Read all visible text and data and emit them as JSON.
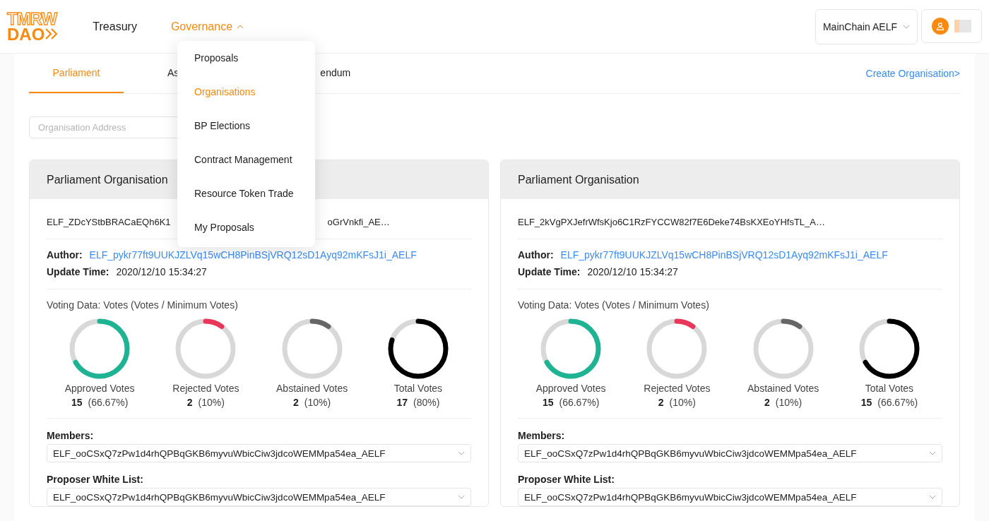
{
  "logo": {
    "top": "TMRW",
    "bottom": "DAO"
  },
  "nav": [
    {
      "label": "Treasury",
      "selected": false,
      "has_caret": false
    },
    {
      "label": "Governance",
      "selected": true,
      "has_caret": true
    }
  ],
  "chain_select": {
    "value": "MainChain AELF"
  },
  "dropdown": [
    {
      "label": "Proposals",
      "selected": false
    },
    {
      "label": "Organisations",
      "selected": true
    },
    {
      "label": "BP Elections",
      "selected": false
    },
    {
      "label": "Contract Management",
      "selected": false
    },
    {
      "label": "Resource Token Trade",
      "selected": false
    },
    {
      "label": "My Proposals",
      "selected": false
    }
  ],
  "tabs": [
    {
      "label": "Parliament",
      "selected": true
    },
    {
      "label": "As",
      "selected": false
    },
    {
      "label": "endum",
      "selected": false
    }
  ],
  "create_link": "Create Organisation>",
  "search": {
    "placeholder": "Organisation Address"
  },
  "cards": [
    {
      "title": "Parliament Organisation",
      "address": [
        "ELF_ZDcYStbBRACaEQh6K1",
        "oGrVnkfi_AE…"
      ],
      "author_label": "Author:",
      "author": "ELF_pykr77ft9UUKJZLVq15wCH8PinBSjVRQ12sD1Ayq92mKFsJ1i_AELF",
      "time_label": "Update Time:",
      "time": "2020/12/10 15:34:27",
      "voting_title": "Voting Data: Votes (Votes / Minimum Votes)",
      "votes": [
        {
          "label": "Approved Votes",
          "count": "15",
          "pct": "(66.67%)",
          "color": "#1db393",
          "level": 0.6667
        },
        {
          "label": "Rejected Votes",
          "count": "2",
          "pct": "(10%)",
          "color": "#e8375a",
          "level": 0.1
        },
        {
          "label": "Abstained Votes",
          "count": "2",
          "pct": "(10%)",
          "color": "#666666",
          "level": 0.1
        },
        {
          "label": "Total Votes",
          "count": "17",
          "pct": "(80%)",
          "color": "#000000",
          "level": 0.8
        }
      ],
      "members_label": "Members:",
      "members": "ELF_ooCSxQ7zPw1d4rhQPBqGKB6myvuWbicCiw3jdcoWEMMpa54ea_AELF",
      "whitelist_label": "Proposer White List:",
      "whitelist": "ELF_ooCSxQ7zPw1d4rhQPBqGKB6myvuWbicCiw3jdcoWEMMpa54ea_AELF"
    },
    {
      "title": "Parliament Organisation",
      "address": [
        "ELF_2kVgPXJefrWfsKjo6C1RzFYCCW82f7E6Deke74BsKXEoYHfsTL_A…"
      ],
      "author_label": "Author:",
      "author": "ELF_pykr77ft9UUKJZLVq15wCH8PinBSjVRQ12sD1Ayq92mKFsJ1i_AELF",
      "time_label": "Update Time:",
      "time": "2020/12/10 15:34:27",
      "voting_title": "Voting Data: Votes (Votes / Minimum Votes)",
      "votes": [
        {
          "label": "Approved Votes",
          "count": "15",
          "pct": "(66.67%)",
          "color": "#1db393",
          "level": 0.6667
        },
        {
          "label": "Rejected Votes",
          "count": "2",
          "pct": "(10%)",
          "color": "#e8375a",
          "level": 0.1
        },
        {
          "label": "Abstained Votes",
          "count": "2",
          "pct": "(10%)",
          "color": "#666666",
          "level": 0.1
        },
        {
          "label": "Total Votes",
          "count": "15",
          "pct": "(66.67%)",
          "color": "#000000",
          "level": 0.6667
        }
      ],
      "members_label": "Members:",
      "members": "ELF_ooCSxQ7zPw1d4rhQPBqGKB6myvuWbicCiw3jdcoWEMMpa54ea_AELF",
      "whitelist_label": "Proposer White List:",
      "whitelist": "ELF_ooCSxQ7zPw1d4rhQPBqGKB6myvuWbicCiw3jdcoWEMMpa54ea_AELF"
    }
  ]
}
